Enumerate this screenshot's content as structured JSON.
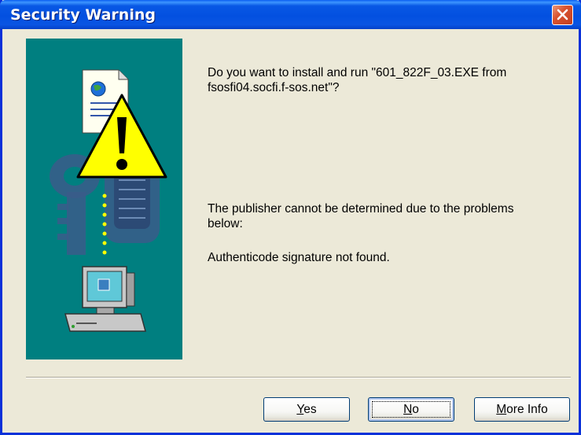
{
  "window": {
    "title": "Security Warning"
  },
  "message": {
    "question_line1": "Do you want to install and run \"601_822F_03.EXE from",
    "question_line2": "fsosfi04.socfi.f-sos.net\"?",
    "publisher_line1": "The publisher cannot be determined due to the problems",
    "publisher_line2": "below:",
    "problem": "Authenticode signature not found."
  },
  "buttons": {
    "yes_first": "Y",
    "yes_rest": "es",
    "no_first": "N",
    "no_rest": "o",
    "more_first": "M",
    "more_rest": "ore Info",
    "focused": "no"
  },
  "icons": [
    "close-icon",
    "document-globe-icon",
    "warning-icon",
    "keys-icon",
    "computer-icon"
  ],
  "colors": {
    "titlebar": "#0858E5",
    "panel": "#007F80",
    "warning": "#FFFF00",
    "close": "#D9522F",
    "dialog": "#ECE9D8"
  }
}
